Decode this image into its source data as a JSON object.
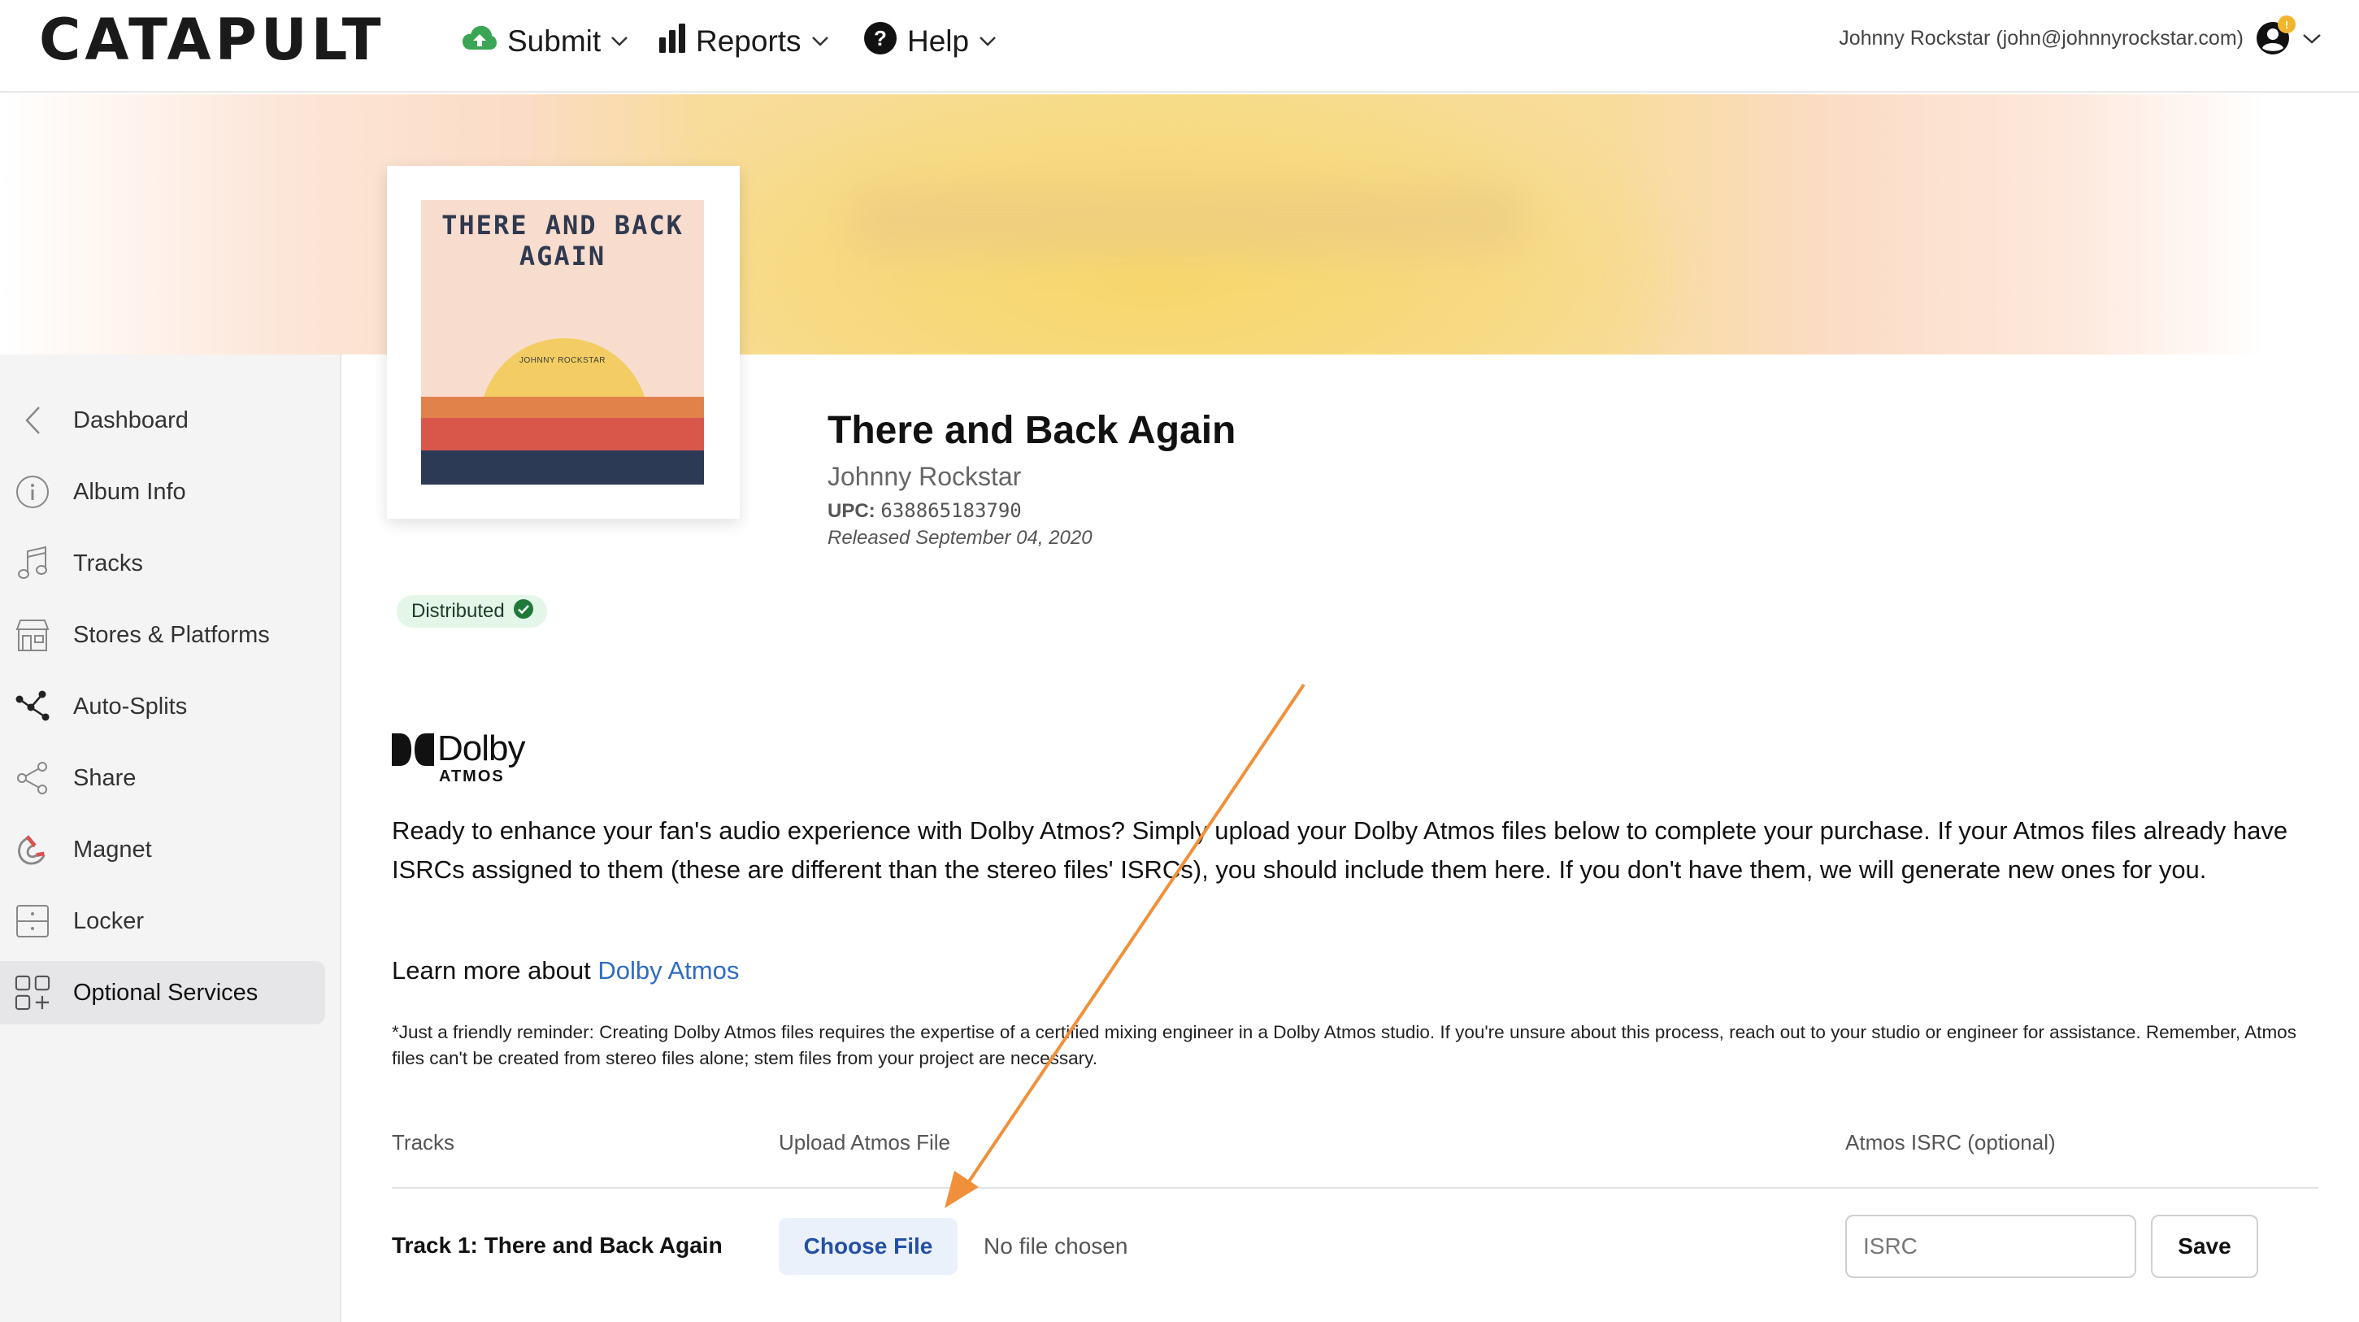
{
  "header": {
    "logo": "CATAPULT",
    "nav": [
      {
        "label": "Submit",
        "icon": "cloud-upload-icon"
      },
      {
        "label": "Reports",
        "icon": "bar-chart-icon"
      },
      {
        "label": "Help",
        "icon": "help-circle-icon"
      }
    ],
    "user": "Johnny Rockstar (john@johnnyrockstar.com)",
    "notification_badge": "!"
  },
  "sidebar": {
    "items": [
      {
        "label": "Dashboard",
        "icon": "chevron-left-icon"
      },
      {
        "label": "Album Info",
        "icon": "info-icon"
      },
      {
        "label": "Tracks",
        "icon": "music-note-icon"
      },
      {
        "label": "Stores & Platforms",
        "icon": "store-icon"
      },
      {
        "label": "Auto-Splits",
        "icon": "split-icon"
      },
      {
        "label": "Share",
        "icon": "share-icon"
      },
      {
        "label": "Magnet",
        "icon": "magnet-icon"
      },
      {
        "label": "Locker",
        "icon": "locker-icon"
      },
      {
        "label": "Optional Services",
        "icon": "grid-plus-icon",
        "active": true
      }
    ]
  },
  "album": {
    "art_title": "THERE AND BACK AGAIN",
    "art_artist": "JOHNNY ROCKSTAR",
    "title": "There and Back Again",
    "artist": "Johnny Rockstar",
    "upc_label": "UPC:",
    "upc": "638865183790",
    "released": "Released September 04, 2020",
    "status": "Distributed"
  },
  "dolby": {
    "logo_word": "Dolby",
    "logo_sub": "ATMOS",
    "description": "Ready to enhance your fan's audio experience with Dolby Atmos? Simply upload your Dolby Atmos files below to complete your purchase. If your Atmos files already have ISRCs assigned to them (these are different than the stereo files' ISRCs), you should include them here. If you don't have them, we will generate new ones for you.",
    "learn_more_prefix": "Learn more about ",
    "learn_more_link": "Dolby Atmos",
    "reminder": "*Just a friendly reminder: Creating Dolby Atmos files requires the expertise of a certified mixing engineer in a Dolby Atmos studio. If you're unsure about this process, reach out to your studio or engineer for assistance. Remember, Atmos files can't be created from stereo files alone; stem files from your project are necessary."
  },
  "table": {
    "headers": [
      "Tracks",
      "Upload Atmos File",
      "Atmos ISRC (optional)"
    ],
    "rows": [
      {
        "track": "Track 1: There and Back Again",
        "choose_label": "Choose File",
        "file_status": "No file chosen",
        "isrc_placeholder": "ISRC",
        "isrc_value": "",
        "save_label": "Save"
      }
    ]
  },
  "colors": {
    "accent_link": "#2f6cc4",
    "status_bg": "#e4f6e7",
    "status_check": "#1f7a3a",
    "arrow": "#f0903a",
    "submit_icon": "#3aa655"
  }
}
